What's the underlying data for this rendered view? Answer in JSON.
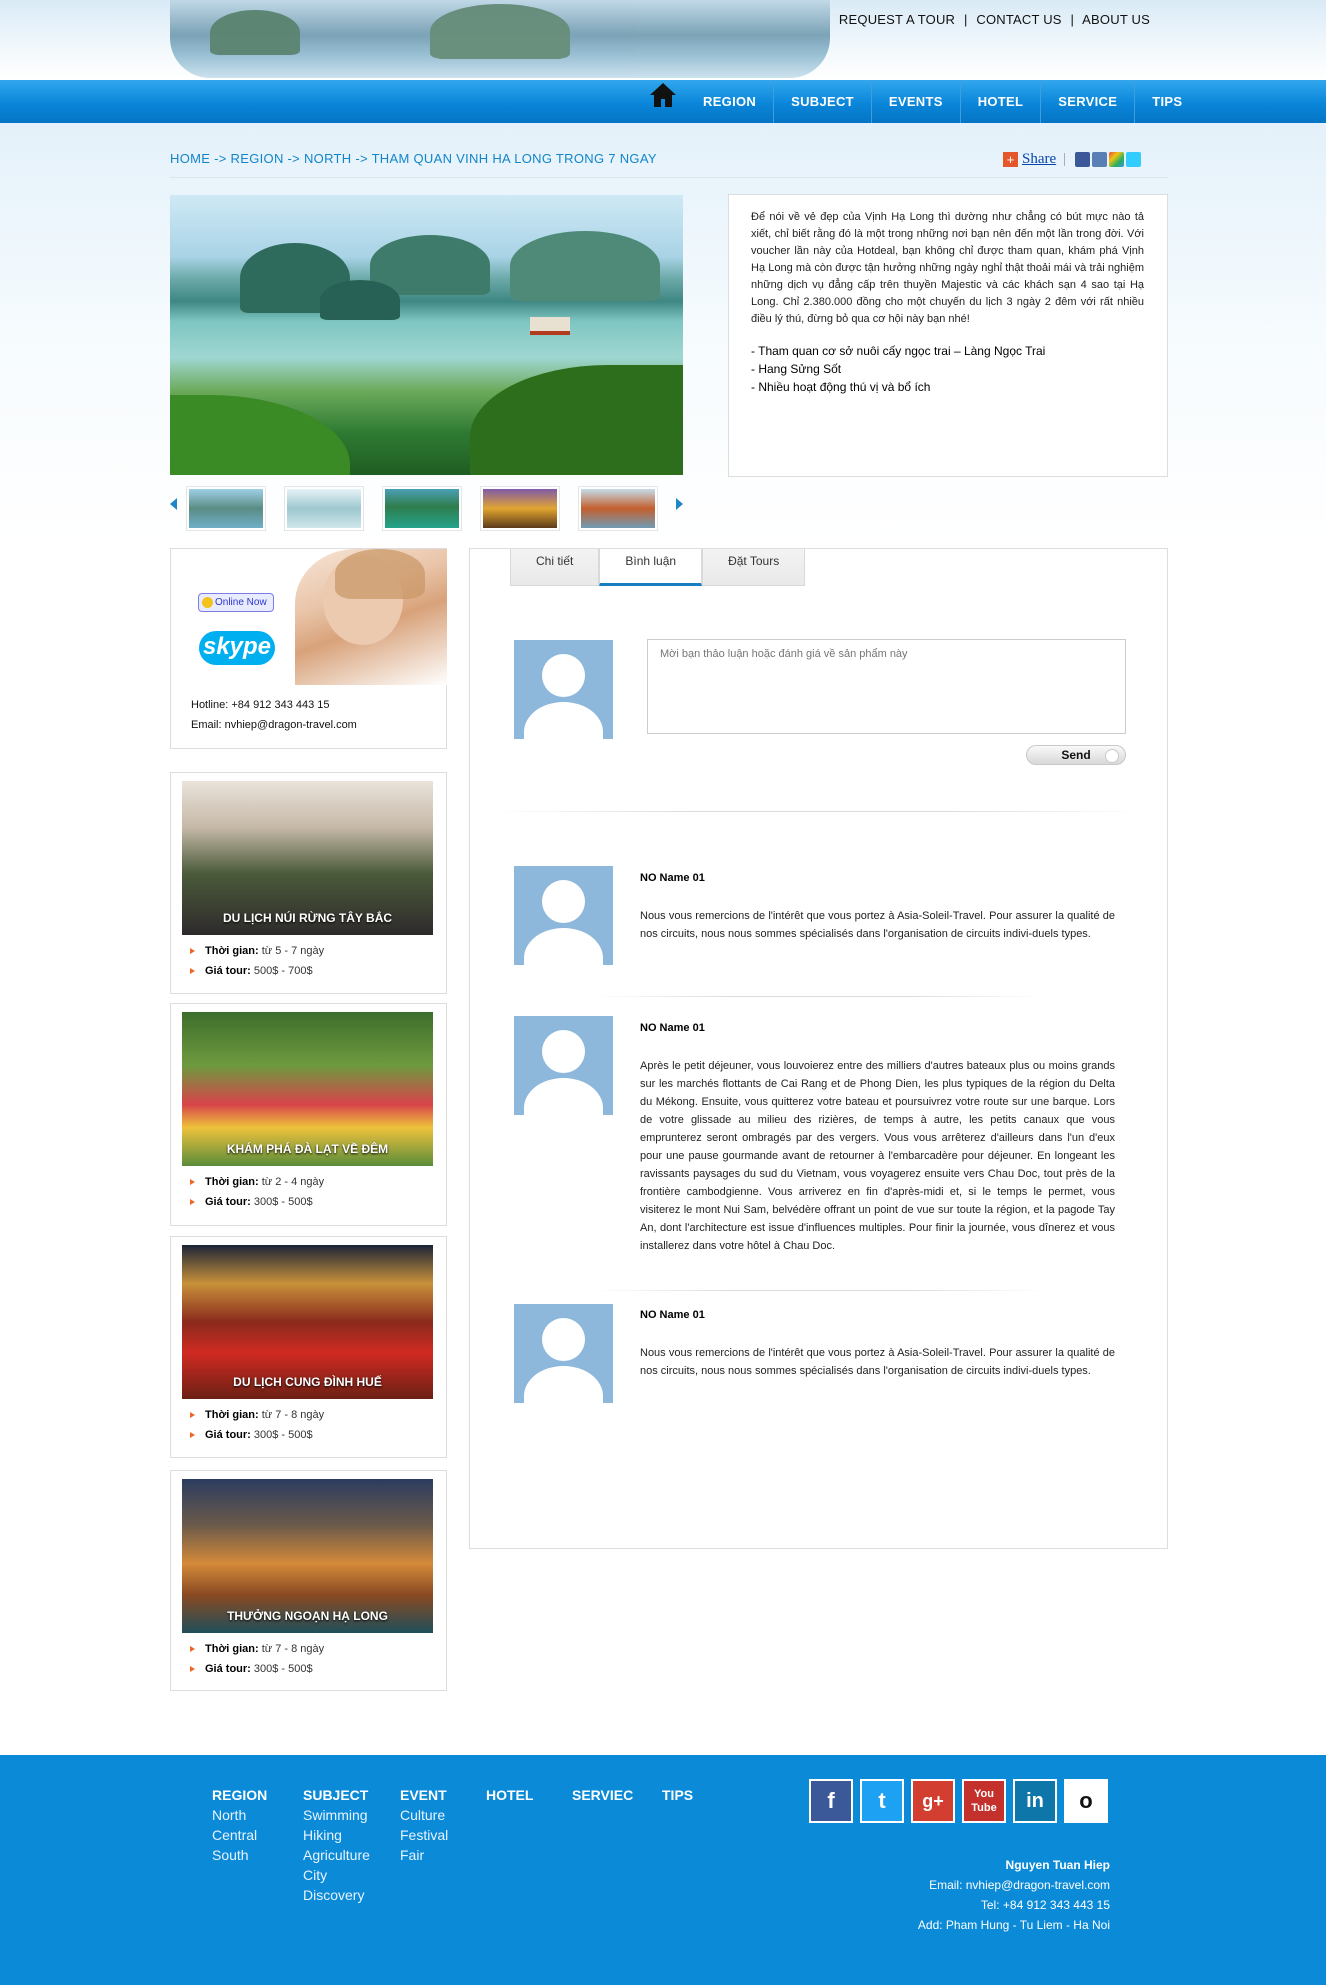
{
  "top_links": [
    "REQUEST A TOUR",
    "CONTACT US",
    "ABOUT US"
  ],
  "nav": {
    "home_icon": "home-icon",
    "items": [
      "REGION",
      "SUBJECT",
      "EVENTS",
      "HOTEL",
      "SERVICE",
      "TIPS"
    ]
  },
  "breadcrumb": "HOME -> REGION -> NORTH -> THAM QUAN VINH HA LONG TRONG 7 NGAY",
  "share": {
    "label": "Share",
    "icons": [
      "facebook-icon",
      "myspace-icon",
      "google-icon",
      "twitter-icon"
    ]
  },
  "description": {
    "paragraph": "Để nói về vẻ đẹp của Vịnh Hạ Long thì dường như chẳng có bút mực nào tả xiết, chỉ biết rằng đó là một trong những nơi bạn nên đến một lần trong đời. Với voucher lần này của Hotdeal, bạn không chỉ được tham quan, khám phá Vịnh Hạ Long mà còn được tận hưởng những ngày nghỉ thật thoải mái và trải nghiệm những dịch vụ đẳng cấp trên thuyền Majestic và các khách sạn 4 sao tại Hạ Long. Chỉ 2.380.000 đồng cho một chuyến du lịch 3 ngày 2 đêm với rất nhiều điều lý thú, đừng bỏ qua cơ hội này bạn nhé!",
    "bullets": [
      "- Tham quan cơ sở nuôi cấy ngọc trai – Làng Ngọc Trai",
      "- Hang Sửng Sốt",
      "- Nhiều hoạt động thú vị và bổ ích"
    ]
  },
  "contact": {
    "online_label": "Online Now",
    "skype_label": "skype",
    "hotline": "Hotline: +84 912 343 443 15",
    "email": "Email: nvhiep@dragon-travel.com"
  },
  "tours": [
    {
      "title": "DU LỊCH NÚI RỪNG TÂY BẮC",
      "time_label": "Thời gian:",
      "time": "từ 5 - 7 ngày",
      "price_label": "Giá tour:",
      "price": "500$ - 700$"
    },
    {
      "title": "KHÁM PHÁ ĐÀ LẠT VỀ ĐÊM",
      "time_label": "Thời gian:",
      "time": "từ 2 - 4 ngày",
      "price_label": "Giá tour:",
      "price": "300$ - 500$"
    },
    {
      "title": "DU LỊCH CUNG ĐÌNH HUẾ",
      "time_label": "Thời gian:",
      "time": "từ 7 - 8 ngày",
      "price_label": "Giá tour:",
      "price": "300$ - 500$"
    },
    {
      "title": "THƯỞNG NGOẠN HẠ LONG",
      "time_label": "Thời gian:",
      "time": "từ 7 - 8 ngày",
      "price_label": "Giá tour:",
      "price": "300$ - 500$"
    }
  ],
  "tabs": [
    "Chi tiết",
    "Bình luận",
    "Đặt Tours"
  ],
  "comment_form": {
    "placeholder": "Mời bạn thảo luận hoặc đánh giá về sản phẩm này",
    "send_label": "Send"
  },
  "comments": [
    {
      "name": "NO Name 01",
      "text": "Nous vous remercions de l'intérêt que vous portez à Asia-Soleil-Travel. Pour assurer la qualité de nos circuits, nous nous sommes spécialisés dans l'organisation de circuits indivi-duels types."
    },
    {
      "name": "NO Name 01",
      "text": "Après le petit déjeuner, vous louvoierez entre des milliers d'autres bateaux plus ou moins grands sur les marchés flottants de Cai Rang et de Phong Dien, les plus typiques de la région du Delta du Mékong. Ensuite, vous quitterez votre bateau et poursuivrez votre route sur une barque. Lors de votre glissade au milieu des rizières, de temps à autre, les petits canaux que vous emprunterez seront ombragés par des vergers. Vous vous arrêterez d'ailleurs dans l'un d'eux pour une pause gourmande avant de retourner à l'embarcadère pour déjeuner. En longeant les ravissants paysages du sud du Vietnam, vous voyagerez ensuite vers Chau Doc, tout près de la frontière cambodgienne. Vous arriverez en fin d'après-midi et, si le temps le permet, vous visiterez le mont Nui Sam, belvédère offrant un point de vue sur toute la région, et la pagode Tay An, dont l'architecture est issue d'influences multiples. Pour finir la journée, vous dînerez et vous installerez dans votre hôtel à Chau Doc."
    },
    {
      "name": "NO Name 01",
      "text": "Nous vous remercions de l'intérêt que vous portez à Asia-Soleil-Travel. Pour assurer la qualité de nos circuits, nous nous sommes spécialisés dans l'organisation de circuits indivi-duels types."
    }
  ],
  "footer": {
    "columns": [
      {
        "title": "REGION",
        "items": [
          "North",
          "Central",
          "South"
        ]
      },
      {
        "title": "SUBJECT",
        "items": [
          "Swimming",
          "Hiking",
          "Agriculture",
          "City",
          "Discovery"
        ]
      },
      {
        "title": "EVENT",
        "items": [
          "Culture",
          "Festival",
          "Fair"
        ]
      },
      {
        "title": "HOTEL",
        "items": []
      },
      {
        "title": "SERVIEC",
        "items": []
      },
      {
        "title": "TIPS",
        "items": []
      }
    ],
    "social": [
      {
        "icon": "facebook-icon",
        "glyph": "f",
        "color": "#3b5998"
      },
      {
        "icon": "twitter-icon",
        "glyph": "t",
        "color": "#1da1f2"
      },
      {
        "icon": "google-plus-icon",
        "glyph": "g+",
        "color": "#d23f31"
      },
      {
        "icon": "youtube-icon",
        "glyph": "You Tube",
        "color": "#c4302b"
      },
      {
        "icon": "linkedin-icon",
        "glyph": "in",
        "color": "#0e76a8"
      },
      {
        "icon": "other-social-icon",
        "glyph": "o",
        "color": "#ffffff"
      }
    ],
    "contact": {
      "name": "Nguyen Tuan Hiep",
      "email": "Email: nvhiep@dragon-travel.com",
      "tel": "Tel: +84 912 343 443 15",
      "address": "Add: Pham Hung - Tu Liem - Ha Noi"
    }
  },
  "colors": {
    "nav_blue": "#0a86d9",
    "footer_blue": "#0b8ad8",
    "link_blue": "#1285c9",
    "bullet_orange": "#f0652a"
  }
}
